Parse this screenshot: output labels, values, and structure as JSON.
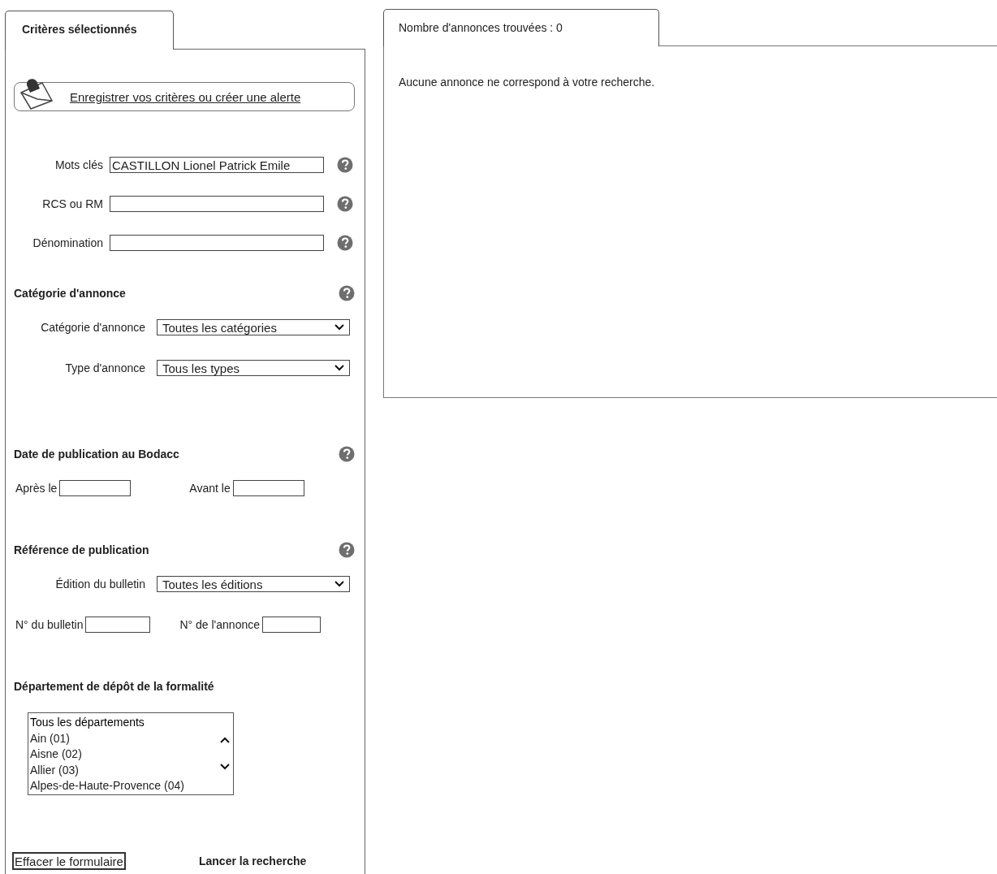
{
  "criteria_panel": {
    "tab_title": "Critères sélectionnés",
    "alert_link": "Enregistrer vos critères ou créer une alerte",
    "text_fields": [
      {
        "label": "Mots clés",
        "value": "CASTILLON Lionel Patrick Emile",
        "help": true
      },
      {
        "label": "RCS ou RM",
        "help": true
      },
      {
        "label": "Dénomination",
        "help": true
      }
    ],
    "category": {
      "heading": "Catégorie d'annonce",
      "help": true,
      "selects": [
        {
          "label": "Catégorie d'annonce",
          "value": "Toutes les catégories"
        },
        {
          "label": "Type d'annonce",
          "value": "Tous les types"
        }
      ]
    },
    "date": {
      "heading": "Date de publication au Bodacc",
      "help": true,
      "fields": [
        {
          "label": "Après le"
        },
        {
          "label": "Avant le"
        }
      ]
    },
    "reference": {
      "heading": "Référence de publication",
      "help": true,
      "select": {
        "label": "Édition du bulletin",
        "value": "Toutes les éditions"
      },
      "fields": [
        {
          "label": "N° du bulletin"
        },
        {
          "label": "N° de l'annonce"
        }
      ]
    },
    "department": {
      "heading": "Département de dépôt de la formalité",
      "help": false,
      "options": [
        "Tous les départements",
        "Ain (01)",
        "Aisne (02)",
        "Allier (03)",
        "Alpes-de-Haute-Provence (04)"
      ]
    },
    "clear_button": "Effacer le formulaire",
    "search_button": "Lancer la recherche"
  },
  "results_panel": {
    "tab_title": "Nombre d'annonces trouvées : 0",
    "message": "Aucune annonce ne correspond à votre recherche."
  }
}
